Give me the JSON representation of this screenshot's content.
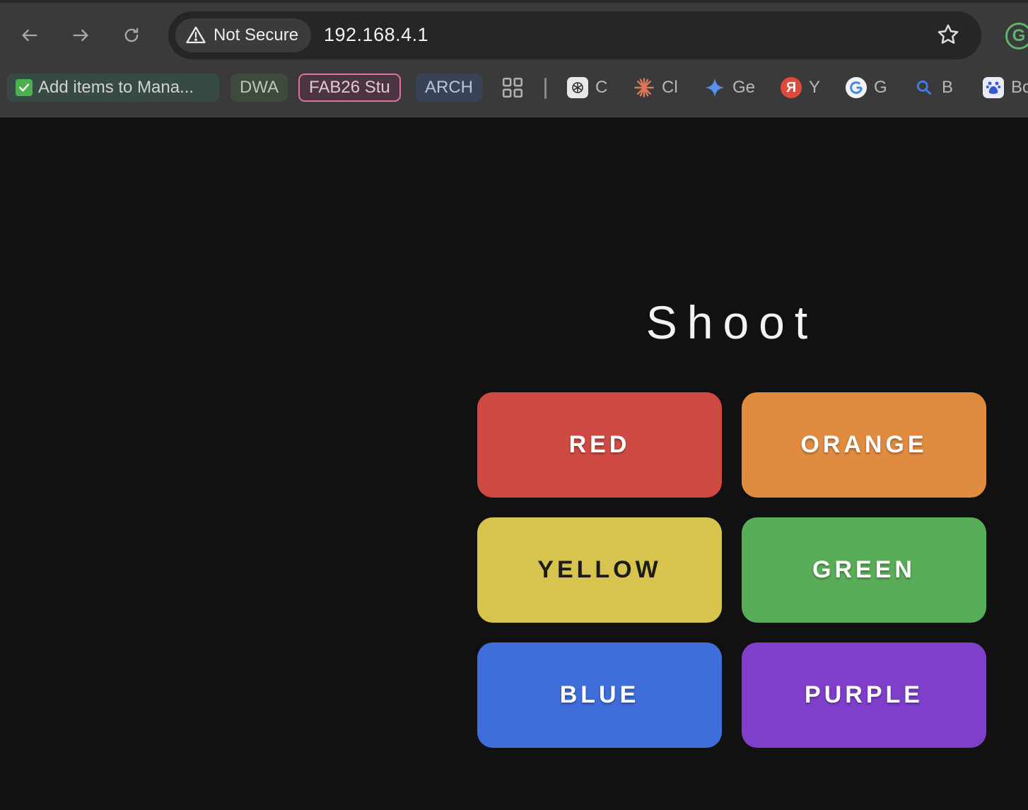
{
  "browser": {
    "security_label": "Not Secure",
    "url": "192.168.4.1",
    "extension_letter": "G"
  },
  "bookmarks": [
    {
      "label": "Add items to Mana...",
      "icon": "check-box-icon",
      "bg": "#384a46",
      "fg": "#d2d2d2"
    },
    {
      "label": "DWA",
      "icon": "",
      "bg": "#3f4a3e",
      "fg": "#b9c9b5"
    },
    {
      "label": "FAB26 Stu",
      "icon": "",
      "bg": "#4a3640",
      "fg": "#e6c4d4",
      "border": "#e070a8"
    },
    {
      "label": "ARCH",
      "icon": "",
      "bg": "#3a4256",
      "fg": "#b9c3d9"
    },
    {
      "label": "",
      "icon": "apps-grid-icon"
    },
    {
      "label": "C",
      "icon": "chatgpt-icon"
    },
    {
      "label": "Cl",
      "icon": "claude-icon"
    },
    {
      "label": "Ge",
      "icon": "gemini-icon"
    },
    {
      "label": "Y",
      "icon": "yandex-icon"
    },
    {
      "label": "G",
      "icon": "google-icon"
    },
    {
      "label": "B",
      "icon": "bing-search-icon"
    },
    {
      "label": "Bo",
      "icon": "baidu-icon"
    }
  ],
  "page": {
    "title": "Shoot",
    "buttons": [
      {
        "label": "RED",
        "color": "#d04a44"
      },
      {
        "label": "ORANGE",
        "color": "#e08c40"
      },
      {
        "label": "YELLOW",
        "color": "#d6c44e"
      },
      {
        "label": "GREEN",
        "color": "#5aad58"
      },
      {
        "label": "BLUE",
        "color": "#3f6edb"
      },
      {
        "label": "PURPLE",
        "color": "#7f3fcb"
      }
    ]
  }
}
